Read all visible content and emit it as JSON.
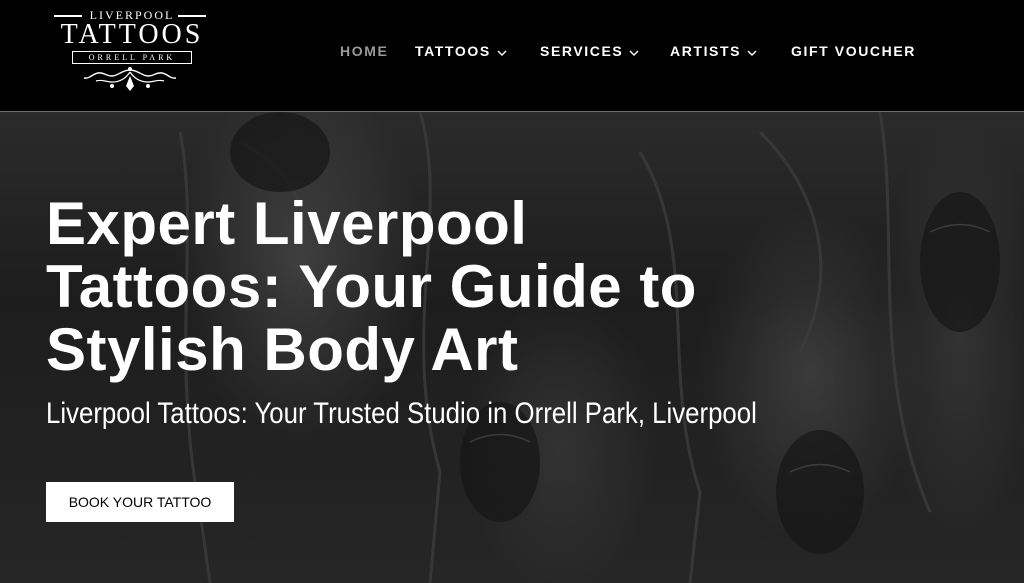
{
  "logo": {
    "top": "LIVERPOOL",
    "main": "TATTOOS",
    "sub": "ORRELL PARK"
  },
  "nav": {
    "items": [
      {
        "label": "HOME",
        "active": true,
        "dropdown": false
      },
      {
        "label": "TATTOOS",
        "active": false,
        "dropdown": true
      },
      {
        "label": "SERVICES",
        "active": false,
        "dropdown": true
      },
      {
        "label": "ARTISTS",
        "active": false,
        "dropdown": true
      },
      {
        "label": "GIFT VOUCHER",
        "active": false,
        "dropdown": false
      }
    ]
  },
  "hero": {
    "title": "Expert Liverpool Tattoos: Your Guide to Stylish Body Art",
    "subtitle": "Liverpool Tattoos: Your Trusted Studio in Orrell Park, Liverpool",
    "cta": "BOOK YOUR TATTOO"
  },
  "colors": {
    "header_bg": "#000000",
    "nav_active": "#9a9a9a",
    "text": "#ffffff",
    "button_bg": "#ffffff"
  },
  "icons": [
    "chevron-down-icon",
    "logo-ornament"
  ]
}
